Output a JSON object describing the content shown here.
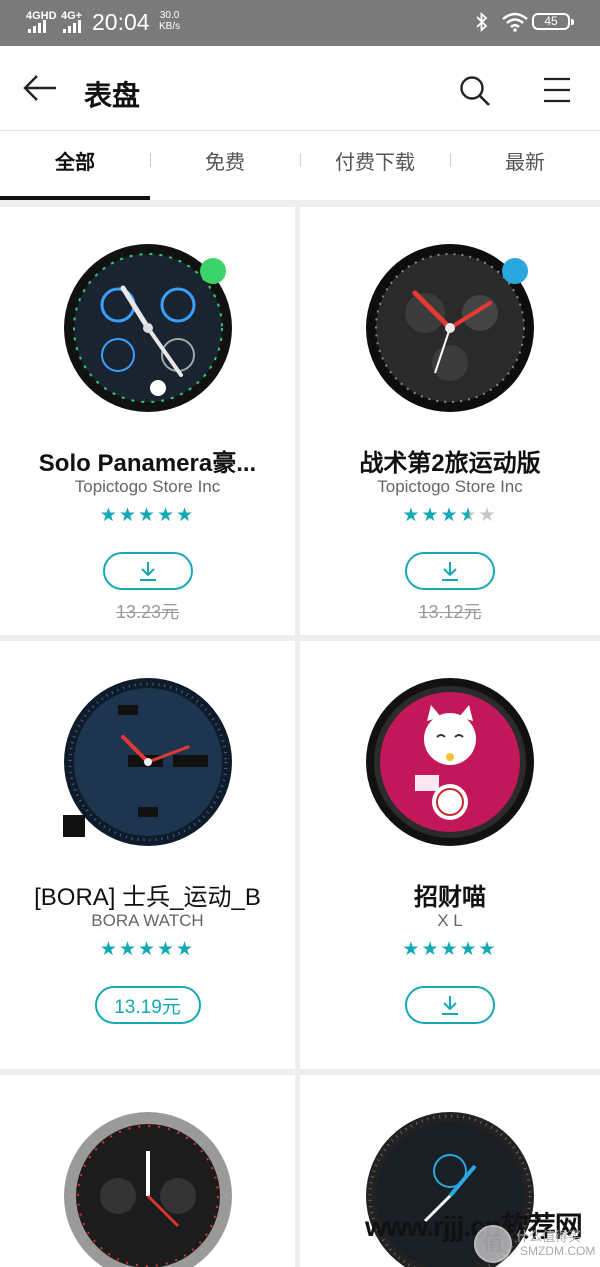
{
  "status": {
    "sig1": "4GHD",
    "sig2": "4G+",
    "time": "20:04",
    "speed_value": "30.0",
    "speed_unit": "KB/s",
    "battery": "45"
  },
  "header": {
    "title": "表盘",
    "back_icon": "arrow-left-icon",
    "search_icon": "search-icon",
    "menu_icon": "menu-icon"
  },
  "tabs": [
    "全部",
    "免费",
    "付费下载",
    "最新"
  ],
  "active_tab": "全部",
  "accent": "#14a9b5",
  "cards": [
    {
      "name": "Solo Panamera豪...",
      "developer": "Topictogo Store Inc",
      "rating": 5,
      "action": "download",
      "old_price": "13.23元"
    },
    {
      "name": "战术第2旅运动版",
      "developer": "Topictogo Store Inc",
      "rating": 3.5,
      "action": "download",
      "old_price": "13.12元"
    },
    {
      "name": "[BORA] 士兵_运动_B",
      "developer": "BORA WATCH",
      "rating": 5,
      "action": "price",
      "price": "13.19元"
    },
    {
      "name": "招财喵",
      "developer": "X L",
      "rating": 5,
      "action": "download"
    }
  ],
  "watermark": {
    "text": "www.rjjj.cn软荐网",
    "logo": "值",
    "site1": "什么值得买",
    "site2": "SMZDM.COM"
  }
}
